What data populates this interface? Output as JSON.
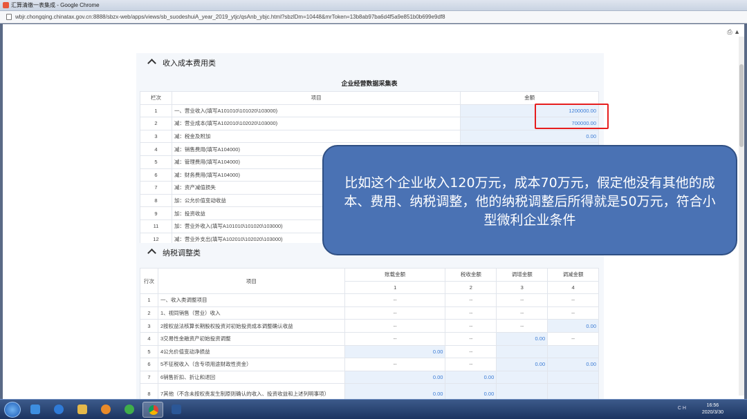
{
  "browser": {
    "title": "汇算清缴一表集成 - Google Chrome",
    "url": "wbjr.chongqing.chinatax.gov.cn:8888/sbzx-web/apps/views/sb_suodeshuiA_year_2019_ytjc/qsAnb_ybjc.html?sbzlDm=10448&mrToken=13b8ab97ba6d4f5a9e851b0b699e9df8"
  },
  "section1": {
    "label": "收入成本费用类"
  },
  "table1": {
    "title": "企业经营数据采集表",
    "headers": {
      "line": "栏次",
      "item": "项目",
      "amount": "金额"
    },
    "rows": [
      {
        "no": "1",
        "item": "一、营业收入(填写A101010\\101020\\103000)",
        "amount": "1200000.00"
      },
      {
        "no": "2",
        "item": "减：营业成本(填写A102010\\102020\\103000)",
        "amount": "700000.00"
      },
      {
        "no": "3",
        "item": "减：税金及附加",
        "amount": "0.00"
      },
      {
        "no": "4",
        "item": "减：销售费用(填写A104000)",
        "amount": ""
      },
      {
        "no": "5",
        "item": "减：管理费用(填写A104000)",
        "amount": ""
      },
      {
        "no": "6",
        "item": "减：财务费用(填写A104000)",
        "amount": ""
      },
      {
        "no": "7",
        "item": "减：资产减值损失",
        "amount": ""
      },
      {
        "no": "8",
        "item": "加：公允价值变动收益",
        "amount": ""
      },
      {
        "no": "9",
        "item": "加：投资收益",
        "amount": ""
      },
      {
        "no": "11",
        "item": "加：营业外收入(填写A101010\\101020\\103000)",
        "amount": ""
      },
      {
        "no": "12",
        "item": "减：营业外支出(填写A102010\\102020\\103000)",
        "amount": ""
      }
    ]
  },
  "section2": {
    "label": "纳税调整类"
  },
  "table2": {
    "headers": {
      "line": "行次",
      "item": "项目",
      "book": "账载金额",
      "tax": "税收金额",
      "increase": "调增金额",
      "decrease": "调减金额",
      "n1": "1",
      "n2": "2",
      "n3": "3",
      "n4": "4"
    },
    "rows": [
      {
        "no": "1",
        "item": "一、收入类调整项目",
        "c1": "--",
        "c2": "--",
        "c3": "--",
        "c4": "--"
      },
      {
        "no": "2",
        "item": "1、视同销售（营业）收入",
        "c1": "--",
        "c2": "--",
        "c3": "--",
        "c4": "--"
      },
      {
        "no": "3",
        "item": "2按权益法核算长期股权投资对初始投资成本调整确认收益",
        "c1": "--",
        "c2": "--",
        "c3": "--",
        "c4": "0.00"
      },
      {
        "no": "4",
        "item": "3交易性金融资产初始投资调整",
        "c1": "--",
        "c2": "--",
        "c3": "0.00",
        "c4": "--"
      },
      {
        "no": "5",
        "item": "4公允价值变动净损益",
        "c1": "0.00",
        "c2": "--",
        "c3": "",
        "c4": ""
      },
      {
        "no": "6",
        "item": "5不征税收入（含专项用途财政性资金）",
        "c1": "--",
        "c2": "--",
        "c3": "0.00",
        "c4": "0.00"
      },
      {
        "no": "7",
        "item": "6销售折扣、折让和退回",
        "c1": "0.00",
        "c2": "0.00",
        "c3": "",
        "c4": ""
      },
      {
        "no": "8",
        "item": "7其他（不含未按权责发生制原则确认的收入、投资收益和上述列明事项）",
        "c1": "0.00",
        "c2": "0.00",
        "c3": "",
        "c4": ""
      }
    ]
  },
  "callout": {
    "text": "比如这个企业收入120万元，成本70万元，假定他没有其他的成本、费用、纳税调整，他的纳税调整后所得就是50万元，符合小型微利企业条件"
  },
  "taskbar": {
    "time": "16:56",
    "date": "2020/3/30",
    "tray_lang": "CH"
  }
}
